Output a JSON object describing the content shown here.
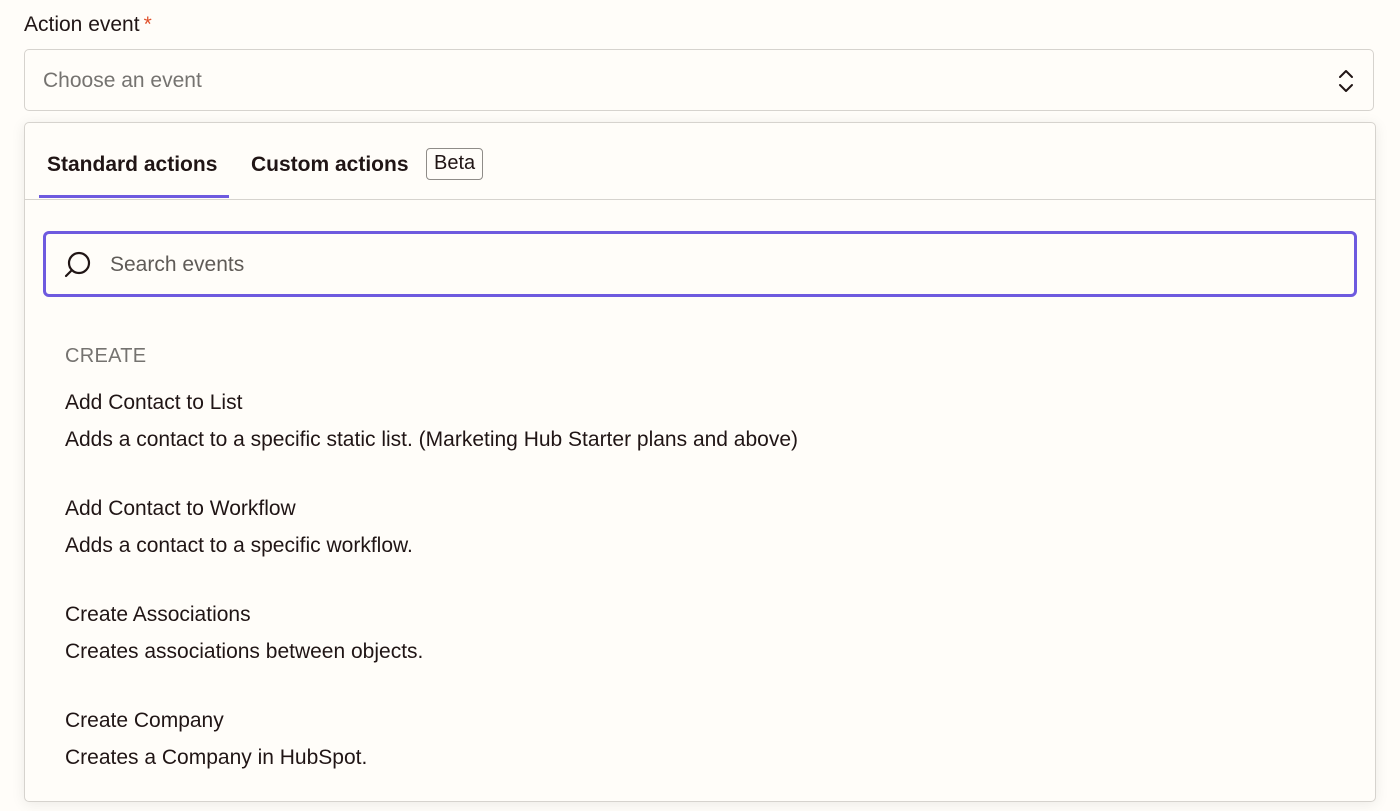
{
  "field": {
    "label": "Action event",
    "required_mark": "*",
    "select_placeholder": "Choose an event"
  },
  "tabs": [
    {
      "label": "Standard actions",
      "active": true
    },
    {
      "label": "Custom actions",
      "active": false,
      "badge": "Beta"
    }
  ],
  "search": {
    "placeholder": "Search events",
    "value": ""
  },
  "section": {
    "heading": "CREATE"
  },
  "events": [
    {
      "title": "Add Contact to List",
      "description": "Adds a contact to a specific static list. (Marketing Hub Starter plans and above)"
    },
    {
      "title": "Add Contact to Workflow",
      "description": "Adds a contact to a specific workflow."
    },
    {
      "title": "Create Associations",
      "description": "Creates associations between objects."
    },
    {
      "title": "Create Company",
      "description": "Creates a Company in HubSpot."
    }
  ],
  "icons": {
    "select": "chevron-up-down-icon",
    "search": "search-icon"
  },
  "colors": {
    "accent": "#6e5adf",
    "required": "#e0502b",
    "background": "#fffdf9",
    "border": "#d6d3ce"
  }
}
